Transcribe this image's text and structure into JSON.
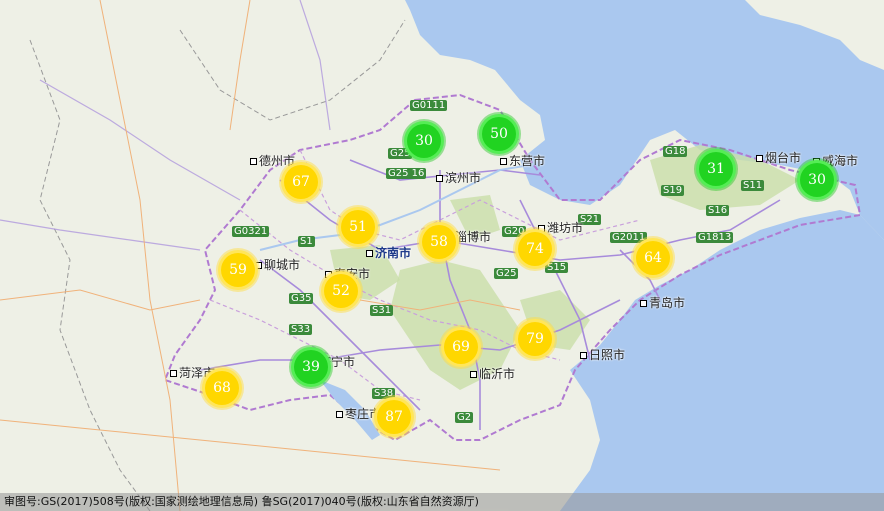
{
  "cities": [
    {
      "name": "德州市",
      "kind": "normal"
    },
    {
      "name": "滨州市",
      "kind": "normal"
    },
    {
      "name": "东营市",
      "kind": "normal"
    },
    {
      "name": "烟台市",
      "kind": "normal"
    },
    {
      "name": "威海市",
      "kind": "normal"
    },
    {
      "name": "潍坊市",
      "kind": "normal"
    },
    {
      "name": "济南市",
      "kind": "capital"
    },
    {
      "name": "淄博市",
      "kind": "normal"
    },
    {
      "name": "聊城市",
      "kind": "normal"
    },
    {
      "name": "泰安市",
      "kind": "normal"
    },
    {
      "name": "青岛市",
      "kind": "normal"
    },
    {
      "name": "日照市",
      "kind": "normal"
    },
    {
      "name": "济宁市",
      "kind": "normal"
    },
    {
      "name": "菏泽市",
      "kind": "normal"
    },
    {
      "name": "临沂市",
      "kind": "normal"
    },
    {
      "name": "枣庄市",
      "kind": "normal"
    }
  ],
  "markers": [
    {
      "value": "30",
      "color": "green"
    },
    {
      "value": "50",
      "color": "green"
    },
    {
      "value": "31",
      "color": "green"
    },
    {
      "value": "30",
      "color": "green"
    },
    {
      "value": "67",
      "color": "yellow"
    },
    {
      "value": "51",
      "color": "yellow"
    },
    {
      "value": "58",
      "color": "yellow"
    },
    {
      "value": "74",
      "color": "yellow"
    },
    {
      "value": "64",
      "color": "yellow"
    },
    {
      "value": "59",
      "color": "yellow"
    },
    {
      "value": "52",
      "color": "yellow"
    },
    {
      "value": "69",
      "color": "yellow"
    },
    {
      "value": "79",
      "color": "yellow"
    },
    {
      "value": "39",
      "color": "green"
    },
    {
      "value": "68",
      "color": "yellow"
    },
    {
      "value": "87",
      "color": "yellow"
    }
  ],
  "road_shields": [
    "G0111",
    "G25",
    "G25 16",
    "G18",
    "S19",
    "S11",
    "S16",
    "G0321",
    "G20",
    "G2011",
    "G1813",
    "S21",
    "G25",
    "S15",
    "S1",
    "G35",
    "S33",
    "S31",
    "S38",
    "G2"
  ],
  "colors": {
    "sea": "#aac8ef",
    "land": "#eef0e6",
    "green_area": "#c9dfa9",
    "yellow_marker": "#ffd700",
    "green_marker": "#21d321"
  },
  "footer": {
    "text": "审图号:GS(2017)508号(版权:国家测绘地理信息局) 鲁SG(2017)040号(版权:山东省自然资源厅)"
  }
}
